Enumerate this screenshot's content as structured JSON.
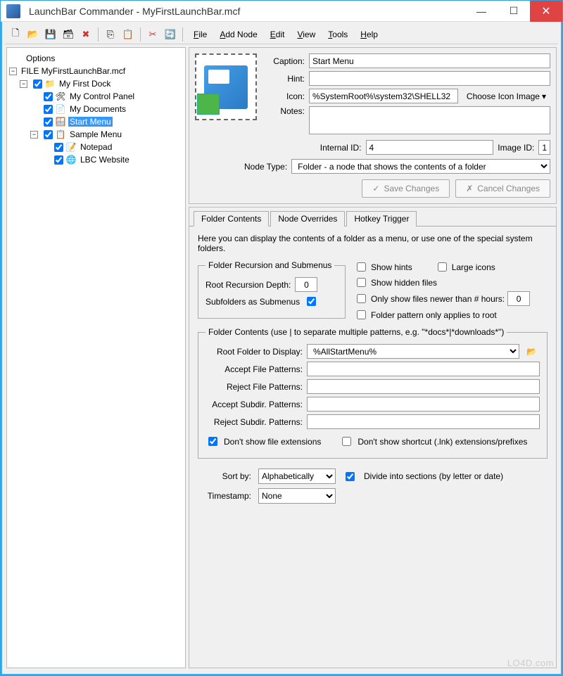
{
  "title": "LaunchBar Commander - MyFirstLaunchBar.mcf",
  "menubar": {
    "file": "File",
    "addnode": "Add Node",
    "edit": "Edit",
    "view": "View",
    "tools": "Tools",
    "help": "Help"
  },
  "tree": {
    "options": "Options",
    "file": "FILE MyFirstLaunchBar.mcf",
    "dock": "My First Dock",
    "items": [
      "My Control Panel",
      "My Documents",
      "Start Menu",
      "Sample Menu"
    ],
    "subitems": [
      "Notepad",
      "LBC Website"
    ]
  },
  "form": {
    "caption_lbl": "Caption:",
    "caption": "Start Menu",
    "hint_lbl": "Hint:",
    "hint": "",
    "icon_lbl": "Icon:",
    "icon": "%SystemRoot%\\system32\\SHELL32",
    "choose": "Choose Icon Image",
    "notes_lbl": "Notes:",
    "notes": "",
    "internal_lbl": "Internal ID:",
    "internal": "4",
    "image_lbl": "Image ID:",
    "image": "1",
    "nodetype_lbl": "Node Type:",
    "nodetype": "Folder - a node that shows the contents of a folder",
    "save": "Save Changes",
    "cancel": "Cancel Changes"
  },
  "tabs": {
    "a": "Folder Contents",
    "b": "Node Overrides",
    "c": "Hotkey Trigger"
  },
  "fc": {
    "desc": "Here you can display the contents of a folder as a menu, or use one of the special system folders.",
    "fs1": "Folder Recursion and Submenus",
    "rrd": "Root Recursion Depth:",
    "rrd_val": "0",
    "sas": "Subfolders as Submenus",
    "showhints": "Show hints",
    "large": "Large icons",
    "hidden": "Show hidden files",
    "newer": "Only show files newer than # hours:",
    "newer_val": "0",
    "rootonly": "Folder pattern only applies to root",
    "fs2": "Folder Contents (use | to separate multiple patterns, e.g. \"*docs*|*downloads*\")",
    "root": "Root Folder to Display:",
    "root_val": "%AllStartMenu%",
    "afp": "Accept File Patterns:",
    "rfp": "Reject File Patterns:",
    "asp": "Accept Subdir. Patterns:",
    "rsp": "Reject Subdir. Patterns:",
    "noext": "Don't show file extensions",
    "nolnk": "Don't show shortcut (.lnk) extensions/prefixes",
    "sortby": "Sort by:",
    "sort_val": "Alphabetically",
    "divide": "Divide into sections (by letter or date)",
    "ts": "Timestamp:",
    "ts_val": "None"
  },
  "watermark": "LO4D.com"
}
